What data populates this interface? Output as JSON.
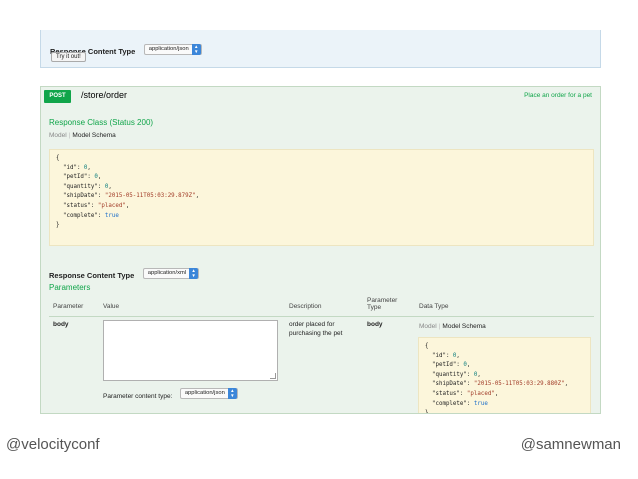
{
  "top_section": {
    "response_content_type_label": "Response Content Type",
    "response_content_type_value": "application/json",
    "try_button_label": "Try it out!"
  },
  "operation": {
    "method": "POST",
    "path": "/store/order",
    "summary": "Place an order for a pet",
    "response_class_title": "Response Class (Status 200)",
    "tabs": {
      "model": "Model",
      "model_schema": "Model Schema"
    },
    "response_content_type_label": "Response Content Type",
    "response_content_type_value": "application/xml",
    "parameters_title": "Parameters",
    "param_table": {
      "headers": {
        "parameter": "Parameter",
        "value": "Value",
        "description": "Description",
        "parameter_type": "Parameter Type",
        "data_type": "Data Type"
      },
      "row": {
        "parameter": "body",
        "description": "order placed for purchasing the pet",
        "parameter_type": "body",
        "content_type_label": "Parameter content type:",
        "content_type_value": "application/json"
      }
    },
    "schema_json": {
      "id": "0",
      "petId": "0",
      "quantity": "0",
      "shipDate": "\"2015-05-11T05:03:29.879Z\"",
      "status": "\"placed\"",
      "complete": "true"
    },
    "param_schema_json": {
      "id": "0",
      "petId": "0",
      "quantity": "0",
      "shipDate": "\"2015-05-11T05:03:29.880Z\"",
      "status": "\"placed\"",
      "complete": "true"
    }
  },
  "footer": {
    "left_handle": "@velocityconf",
    "right_handle": "@samnewman"
  },
  "colors": {
    "green": "#10a54a",
    "code_bg": "#fcf6db",
    "panel_green": "#ebf3ec",
    "panel_blue": "#ebf3f9",
    "select_arrow": "#3b86d9"
  }
}
